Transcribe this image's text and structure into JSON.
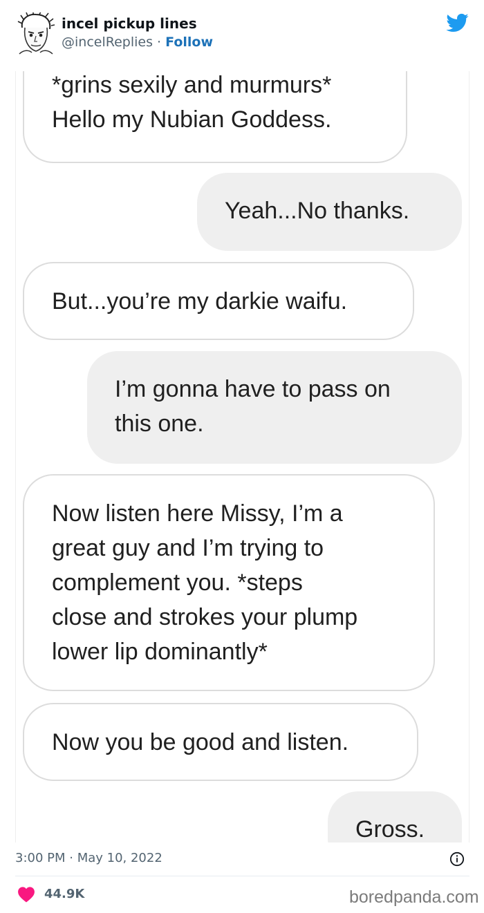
{
  "tweet": {
    "display_name": "incel pickup lines",
    "handle": "@incelReplies",
    "separator": " · ",
    "follow_label": "Follow",
    "timestamp": "3:00 PM · May 10, 2022",
    "likes": "44.9K",
    "icons": {
      "avatar": "sketch-face-avatar",
      "brand": "twitter-bird-icon",
      "info": "info-icon",
      "like": "heart-icon"
    },
    "colors": {
      "brand": "#1d9bf0",
      "like": "#f91880",
      "follow": "#1d72b8"
    }
  },
  "messages": [
    {
      "side": "received",
      "lines": [
        "*grins sexily and murmurs*",
        "Hello my Nubian Goddess."
      ]
    },
    {
      "side": "sent",
      "lines": [
        "Yeah...No thanks."
      ]
    },
    {
      "side": "received",
      "lines": [
        "But...you’re my darkie waifu."
      ]
    },
    {
      "side": "sent",
      "lines": [
        "I’m gonna have to pass on",
        "this one."
      ]
    },
    {
      "side": "received",
      "lines": [
        "Now listen here Missy, I’m a",
        "great guy and I’m trying to",
        "complement you. *steps",
        "close and strokes your plump",
        "lower lip dominantly*"
      ]
    },
    {
      "side": "received",
      "lines": [
        "Now you be good and listen."
      ]
    },
    {
      "side": "sent",
      "lines": [
        "Gross."
      ]
    }
  ],
  "watermark": "boredpanda.com"
}
